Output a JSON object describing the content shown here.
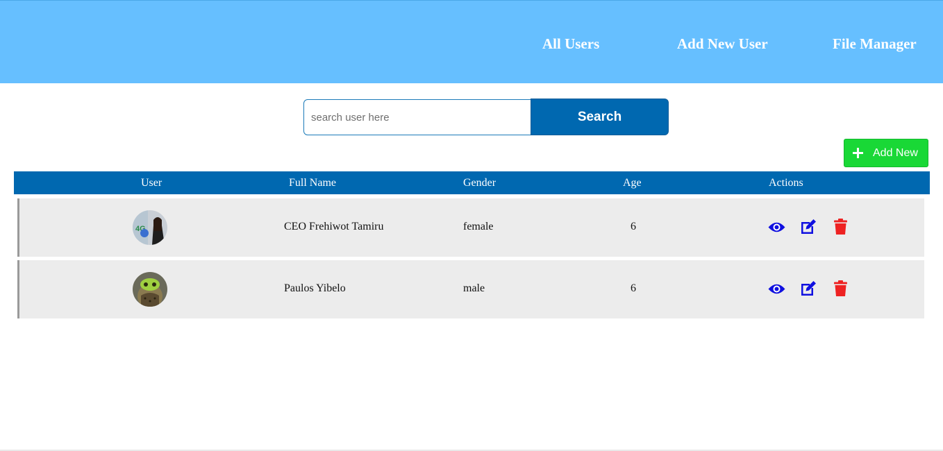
{
  "nav": {
    "links": [
      "All Users",
      "Add New User",
      "File Manager"
    ]
  },
  "search": {
    "placeholder": "search user here",
    "value": "",
    "button_label": "Search"
  },
  "add_button": {
    "label": "Add New",
    "icon": "plus-icon"
  },
  "table": {
    "headers": [
      "User",
      "Full Name",
      "Gender",
      "Age",
      "Actions"
    ],
    "rows": [
      {
        "full_name": "CEO Frehiwot Tamiru",
        "gender": "female",
        "age": "6",
        "avatar": "avatar-photo"
      },
      {
        "full_name": "Paulos Yibelo",
        "gender": "male",
        "age": "6",
        "avatar": "avatar-photo"
      }
    ],
    "actions": [
      "eye-icon",
      "edit-icon",
      "trash-icon"
    ]
  },
  "colors": {
    "header_bg": "#66bfff",
    "primary": "#0068b0",
    "add_green": "#19d836",
    "action_blue": "#1010e0",
    "delete_red": "#ee2222",
    "row_bg": "#ececec"
  }
}
